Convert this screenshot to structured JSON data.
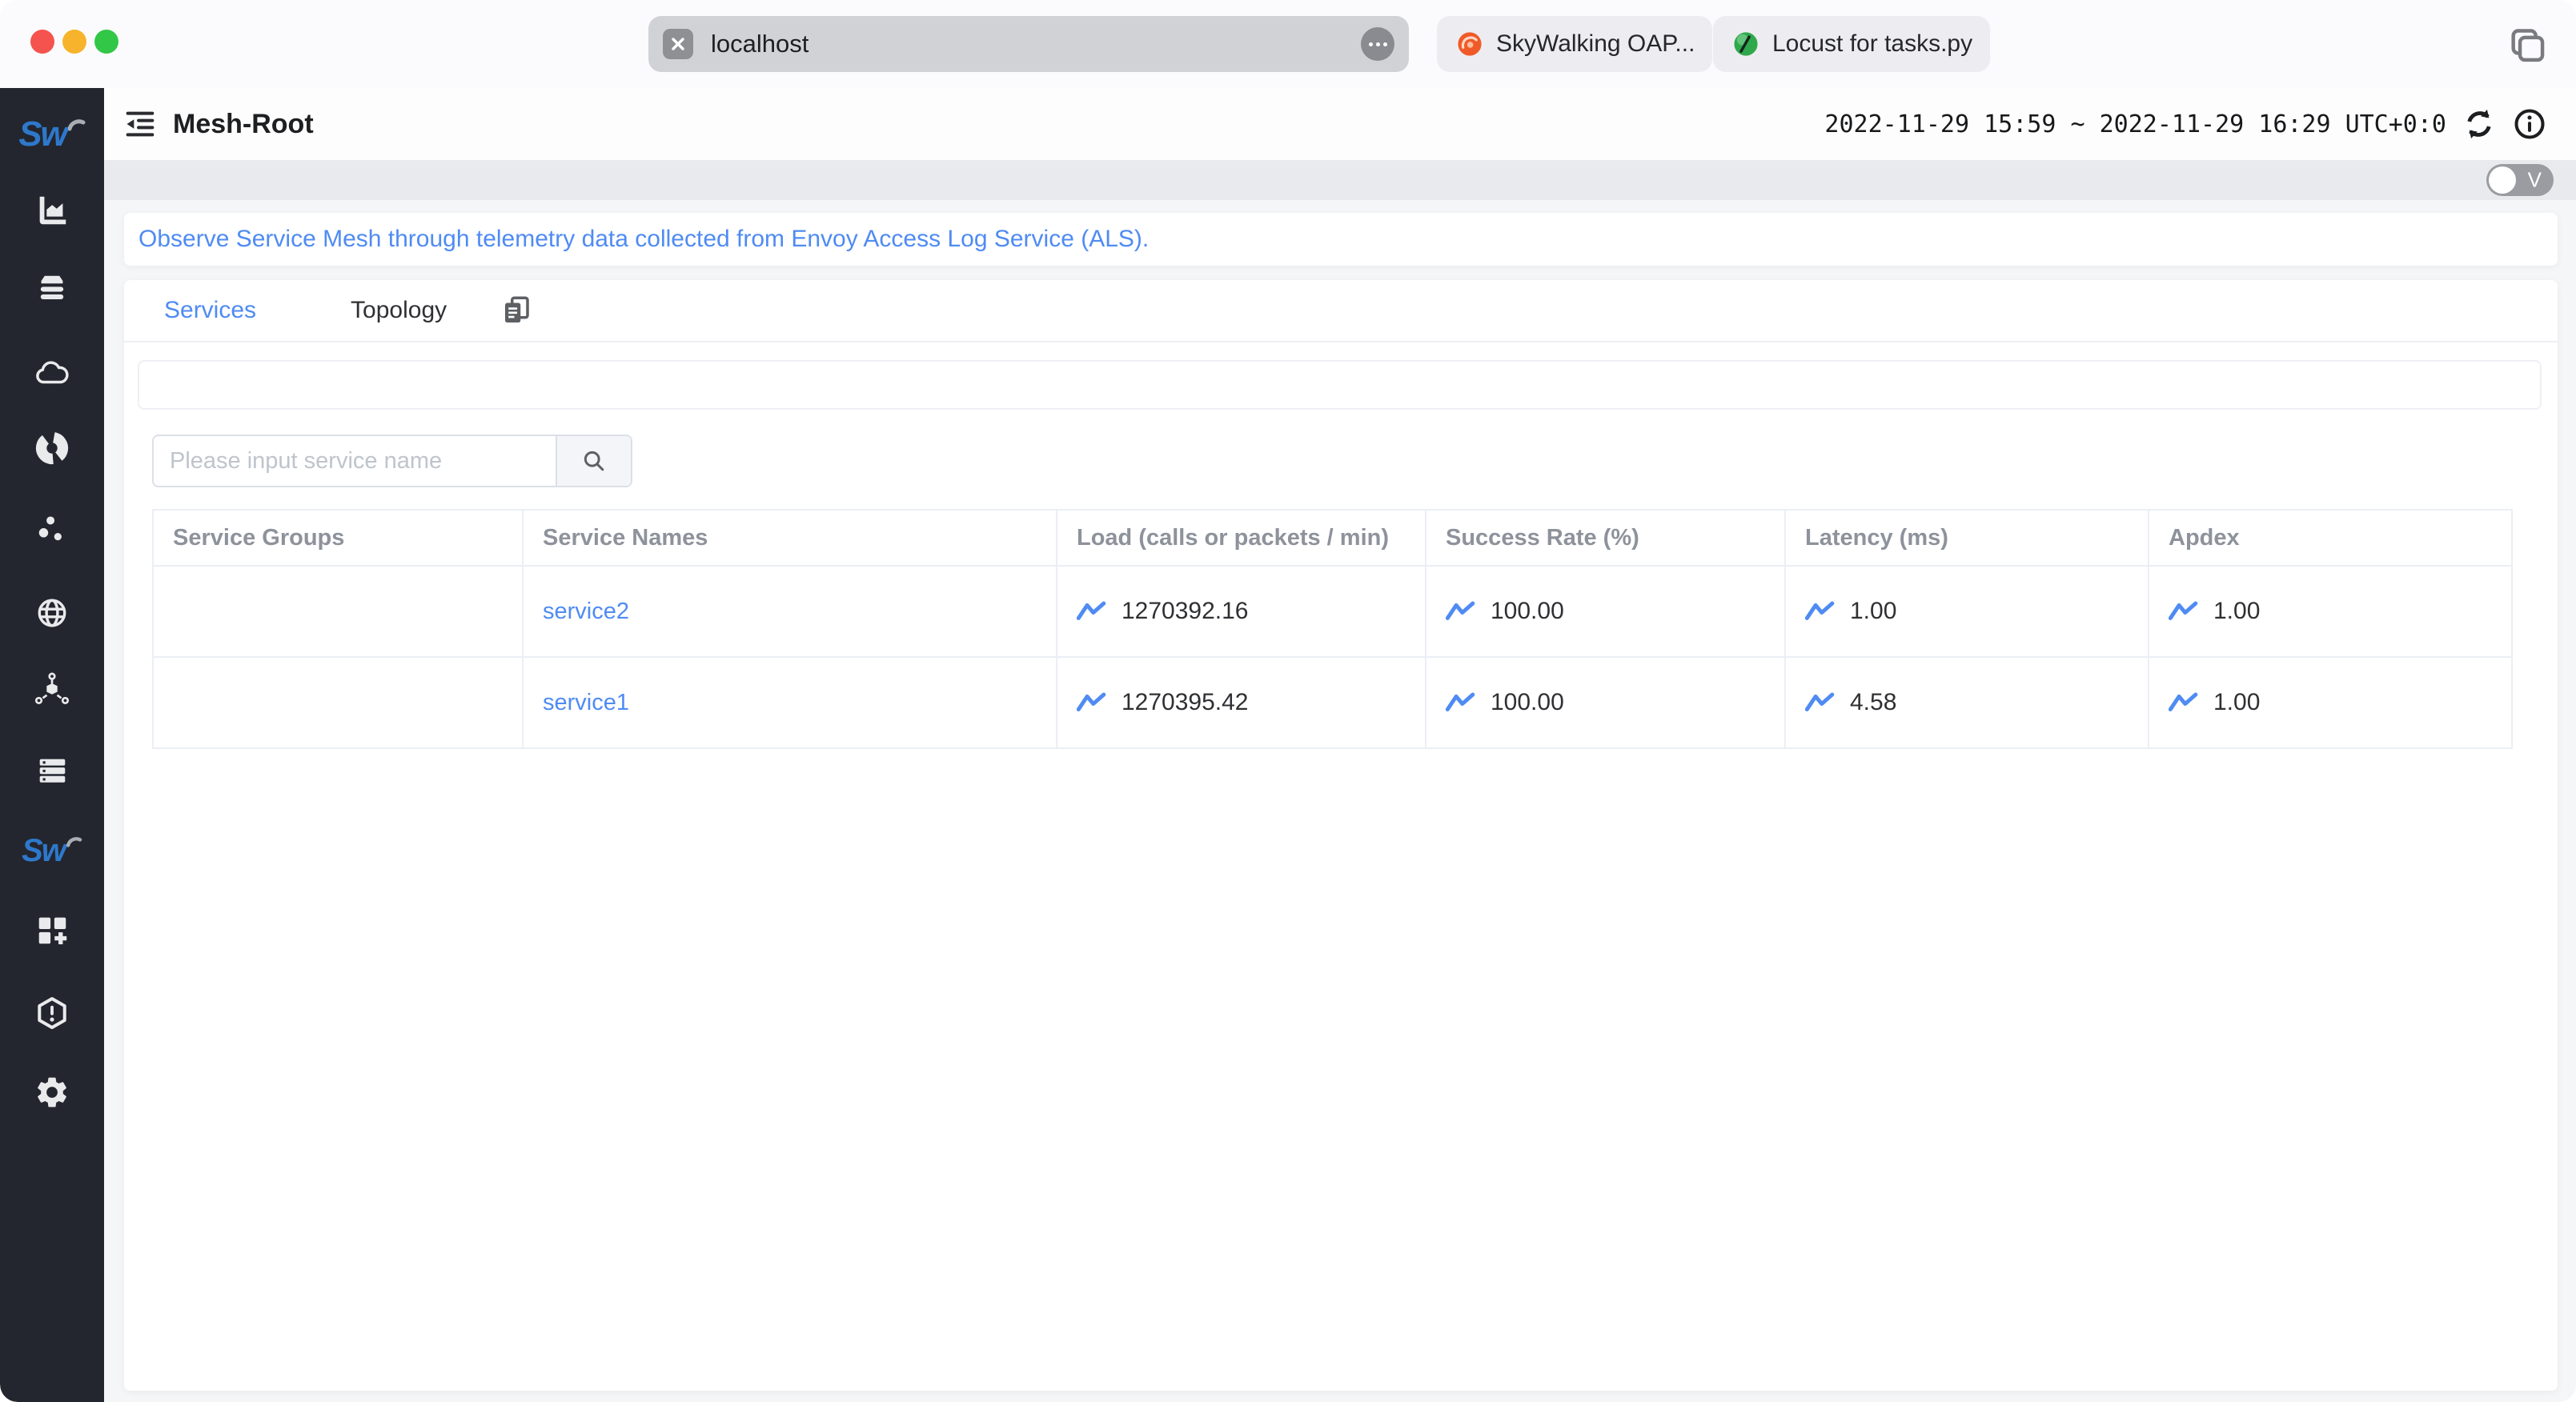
{
  "browser": {
    "url": "localhost",
    "tabs": [
      {
        "label": "SkyWalking OAP..."
      },
      {
        "label": "Locust for tasks.py"
      }
    ]
  },
  "header": {
    "title": "Mesh-Root",
    "time_range": "2022-11-29 15:59 ~ 2022-11-29 16:29",
    "timezone": "UTC+0:0"
  },
  "view_toggle": {
    "label": "V"
  },
  "notice": "Observe Service Mesh through telemetry data collected from Envoy Access Log Service (ALS).",
  "tabs": {
    "services": "Services",
    "topology": "Topology"
  },
  "search": {
    "placeholder": "Please input service name"
  },
  "table": {
    "columns": [
      "Service Groups",
      "Service Names",
      "Load (calls or packets / min)",
      "Success Rate (%)",
      "Latency (ms)",
      "Apdex"
    ],
    "rows": [
      {
        "group": "",
        "name": "service2",
        "load": "1270392.16",
        "success_rate": "100.00",
        "latency": "1.00",
        "apdex": "1.00"
      },
      {
        "group": "",
        "name": "service1",
        "load": "1270395.42",
        "success_rate": "100.00",
        "latency": "4.58",
        "apdex": "1.00"
      }
    ]
  },
  "sidebar": {
    "logo": "Sw",
    "icons": [
      "bar-chart-icon",
      "layers-icon",
      "cloud-icon",
      "donut-chart-icon",
      "scatter-dots-icon",
      "globe-icon",
      "cube-nodes-icon",
      "server-rack-icon",
      "skywalking-icon",
      "grid-plus-icon",
      "hexagon-alert-icon",
      "gear-icon"
    ]
  },
  "colors": {
    "accent": "#4f8bf3",
    "sidebar_bg": "#23262e",
    "success_blue": "#4f8bf3"
  }
}
